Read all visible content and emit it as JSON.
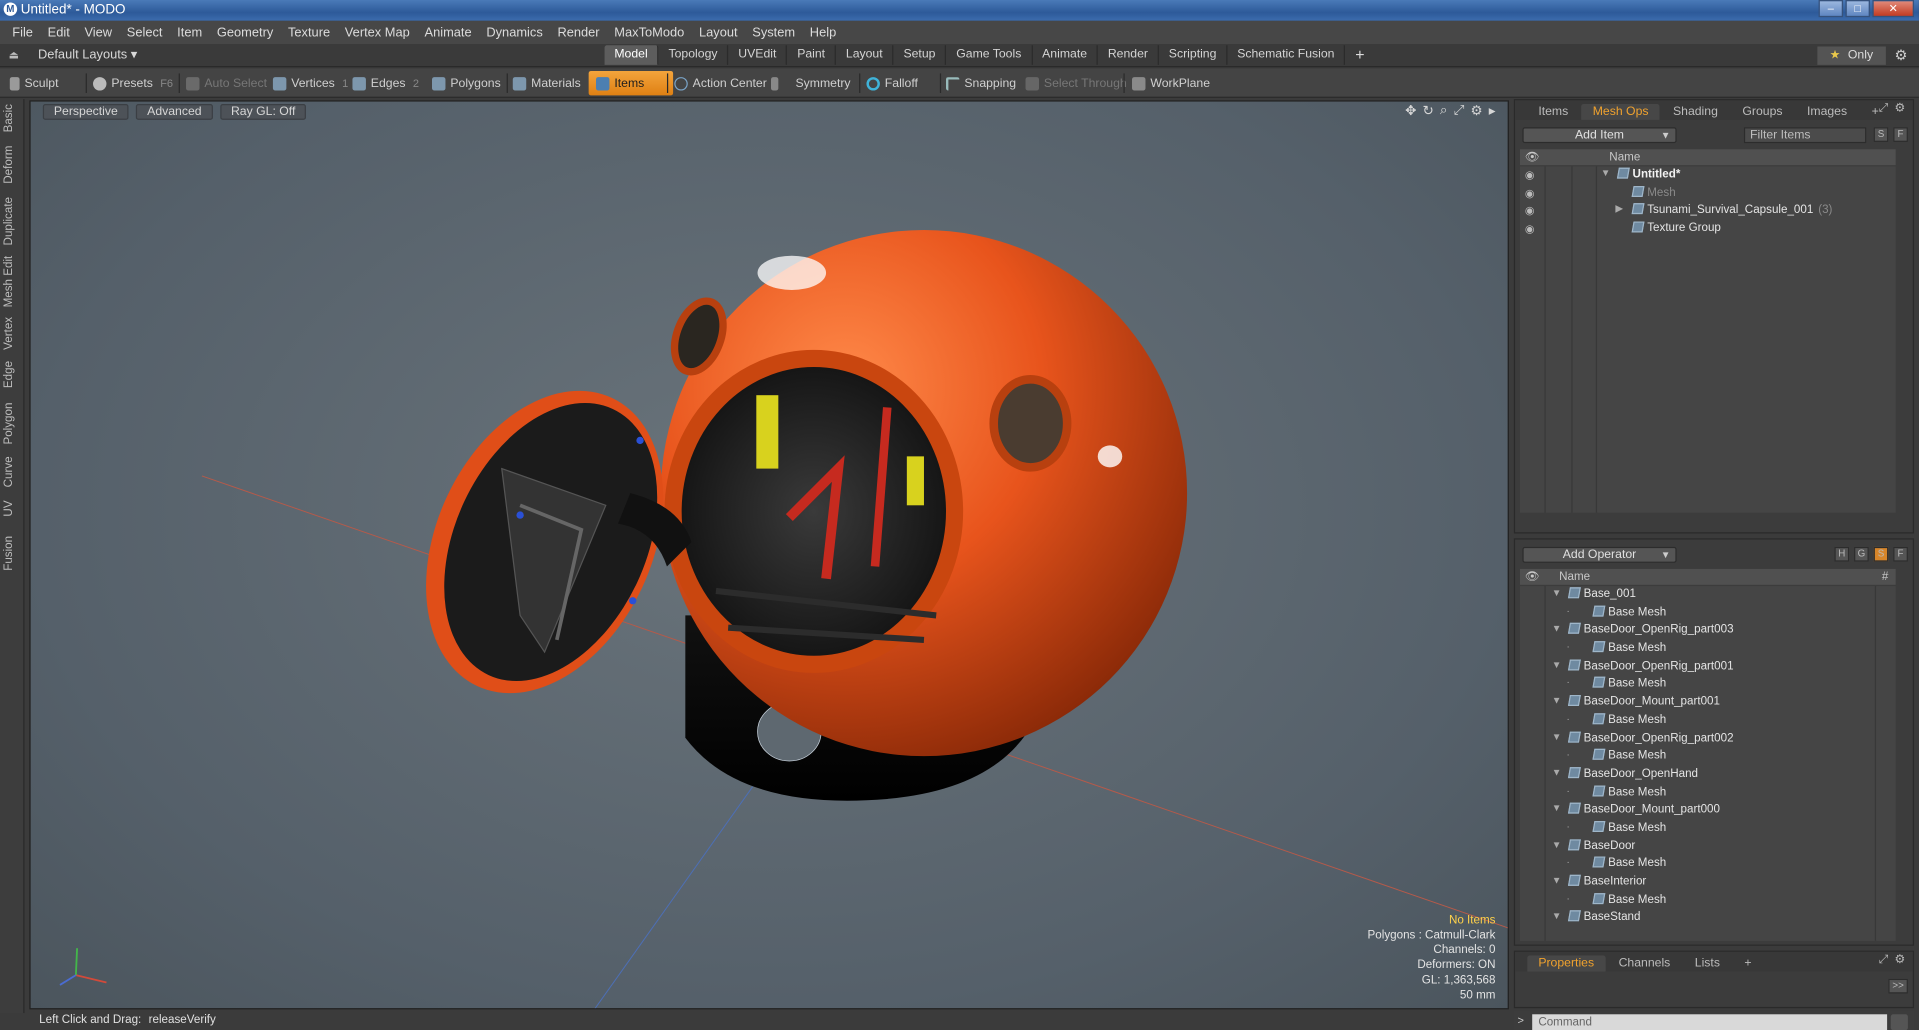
{
  "window": {
    "title": "Untitled* - MODO",
    "logo": "M"
  },
  "menu": [
    "File",
    "Edit",
    "View",
    "Select",
    "Item",
    "Geometry",
    "Texture",
    "Vertex Map",
    "Animate",
    "Dynamics",
    "Render",
    "MaxToModo",
    "Layout",
    "System",
    "Help"
  ],
  "layoutbar": {
    "layout_menu": "Default Layouts ▾",
    "tabs": [
      "Model",
      "Topology",
      "UVEdit",
      "Paint",
      "Layout",
      "Setup",
      "Game Tools",
      "Animate",
      "Render",
      "Scripting",
      "Schematic Fusion"
    ],
    "active_tab": "Model",
    "add_tab": "+",
    "only_label": "Only",
    "only_star": "★"
  },
  "toolbar": {
    "sculpt": "Sculpt",
    "presets": "Presets",
    "presets_key": "F6",
    "auto_select": "Auto Select",
    "vertices": "Vertices",
    "vertices_key": "1",
    "edges": "Edges",
    "edges_key": "2",
    "polygons": "Polygons",
    "materials": "Materials",
    "items": "Items",
    "action_center": "Action Center",
    "symmetry": "Symmetry",
    "falloff": "Falloff",
    "snapping": "Snapping",
    "select_through": "Select Through",
    "workplane": "WorkPlane"
  },
  "left_tabs": [
    "Basic",
    "Deform",
    "Duplicate",
    "Mesh Edit",
    "Vertex",
    "Edge",
    "Polygon",
    "Curve",
    "UV",
    "Fusion"
  ],
  "viewport": {
    "view": "Perspective",
    "shading": "Advanced",
    "raygl": "Ray GL: Off",
    "info": {
      "selection": "No Items",
      "polygons": "Polygons : Catmull-Clark",
      "channels": "Channels: 0",
      "deformers": "Deformers: ON",
      "gl": "GL: 1,363,568",
      "scale": "50 mm"
    }
  },
  "status": {
    "label": "Left Click and Drag:",
    "value": "releaseVerify"
  },
  "items_panel": {
    "tabs": [
      "Items",
      "Mesh Ops",
      "Shading",
      "Groups",
      "Images"
    ],
    "active_tab": "Mesh Ops",
    "add_item": "Add Item",
    "filter_placeholder": "Filter Items",
    "s_btn": "S",
    "f_btn": "F",
    "col_name": "Name",
    "tree": [
      {
        "label": "Untitled*",
        "indent": 0,
        "style": "bold",
        "twirl": "▼",
        "icon": "scene-icon"
      },
      {
        "label": "Mesh",
        "indent": 1,
        "style": "dim",
        "twirl": "",
        "icon": "mesh-icon"
      },
      {
        "label": "Tsunami_Survival_Capsule_001",
        "suffix": "(3)",
        "indent": 1,
        "style": "normal",
        "twirl": "▶",
        "icon": "locator-icon"
      },
      {
        "label": "Texture Group",
        "indent": 1,
        "style": "normal",
        "twirl": "",
        "icon": "group-icon"
      }
    ]
  },
  "meshops_panel": {
    "add_operator": "Add Operator",
    "btns": [
      "H",
      "G",
      "S",
      "F"
    ],
    "col_name": "Name",
    "col_hash": "#",
    "rows": [
      {
        "label": "Base_001",
        "level": 0
      },
      {
        "label": "Base Mesh",
        "level": 1
      },
      {
        "label": "BaseDoor_OpenRig_part003",
        "level": 0
      },
      {
        "label": "Base Mesh",
        "level": 1
      },
      {
        "label": "BaseDoor_OpenRig_part001",
        "level": 0
      },
      {
        "label": "Base Mesh",
        "level": 1
      },
      {
        "label": "BaseDoor_Mount_part001",
        "level": 0
      },
      {
        "label": "Base Mesh",
        "level": 1
      },
      {
        "label": "BaseDoor_OpenRig_part002",
        "level": 0
      },
      {
        "label": "Base Mesh",
        "level": 1
      },
      {
        "label": "BaseDoor_OpenHand",
        "level": 0
      },
      {
        "label": "Base Mesh",
        "level": 1
      },
      {
        "label": "BaseDoor_Mount_part000",
        "level": 0
      },
      {
        "label": "Base Mesh",
        "level": 1
      },
      {
        "label": "BaseDoor",
        "level": 0
      },
      {
        "label": "Base Mesh",
        "level": 1
      },
      {
        "label": "BaseInterior",
        "level": 0
      },
      {
        "label": "Base Mesh",
        "level": 1
      },
      {
        "label": "BaseStand",
        "level": 0
      }
    ]
  },
  "properties_panel": {
    "tabs": [
      "Properties",
      "Channels",
      "Lists"
    ],
    "active_tab": "Properties",
    "expand": ">>"
  },
  "command": {
    "placeholder": "Command"
  },
  "colors": {
    "accent": "#f0a22e",
    "capsule": "#e8541c",
    "viewport_bg": "#5f6a72"
  }
}
